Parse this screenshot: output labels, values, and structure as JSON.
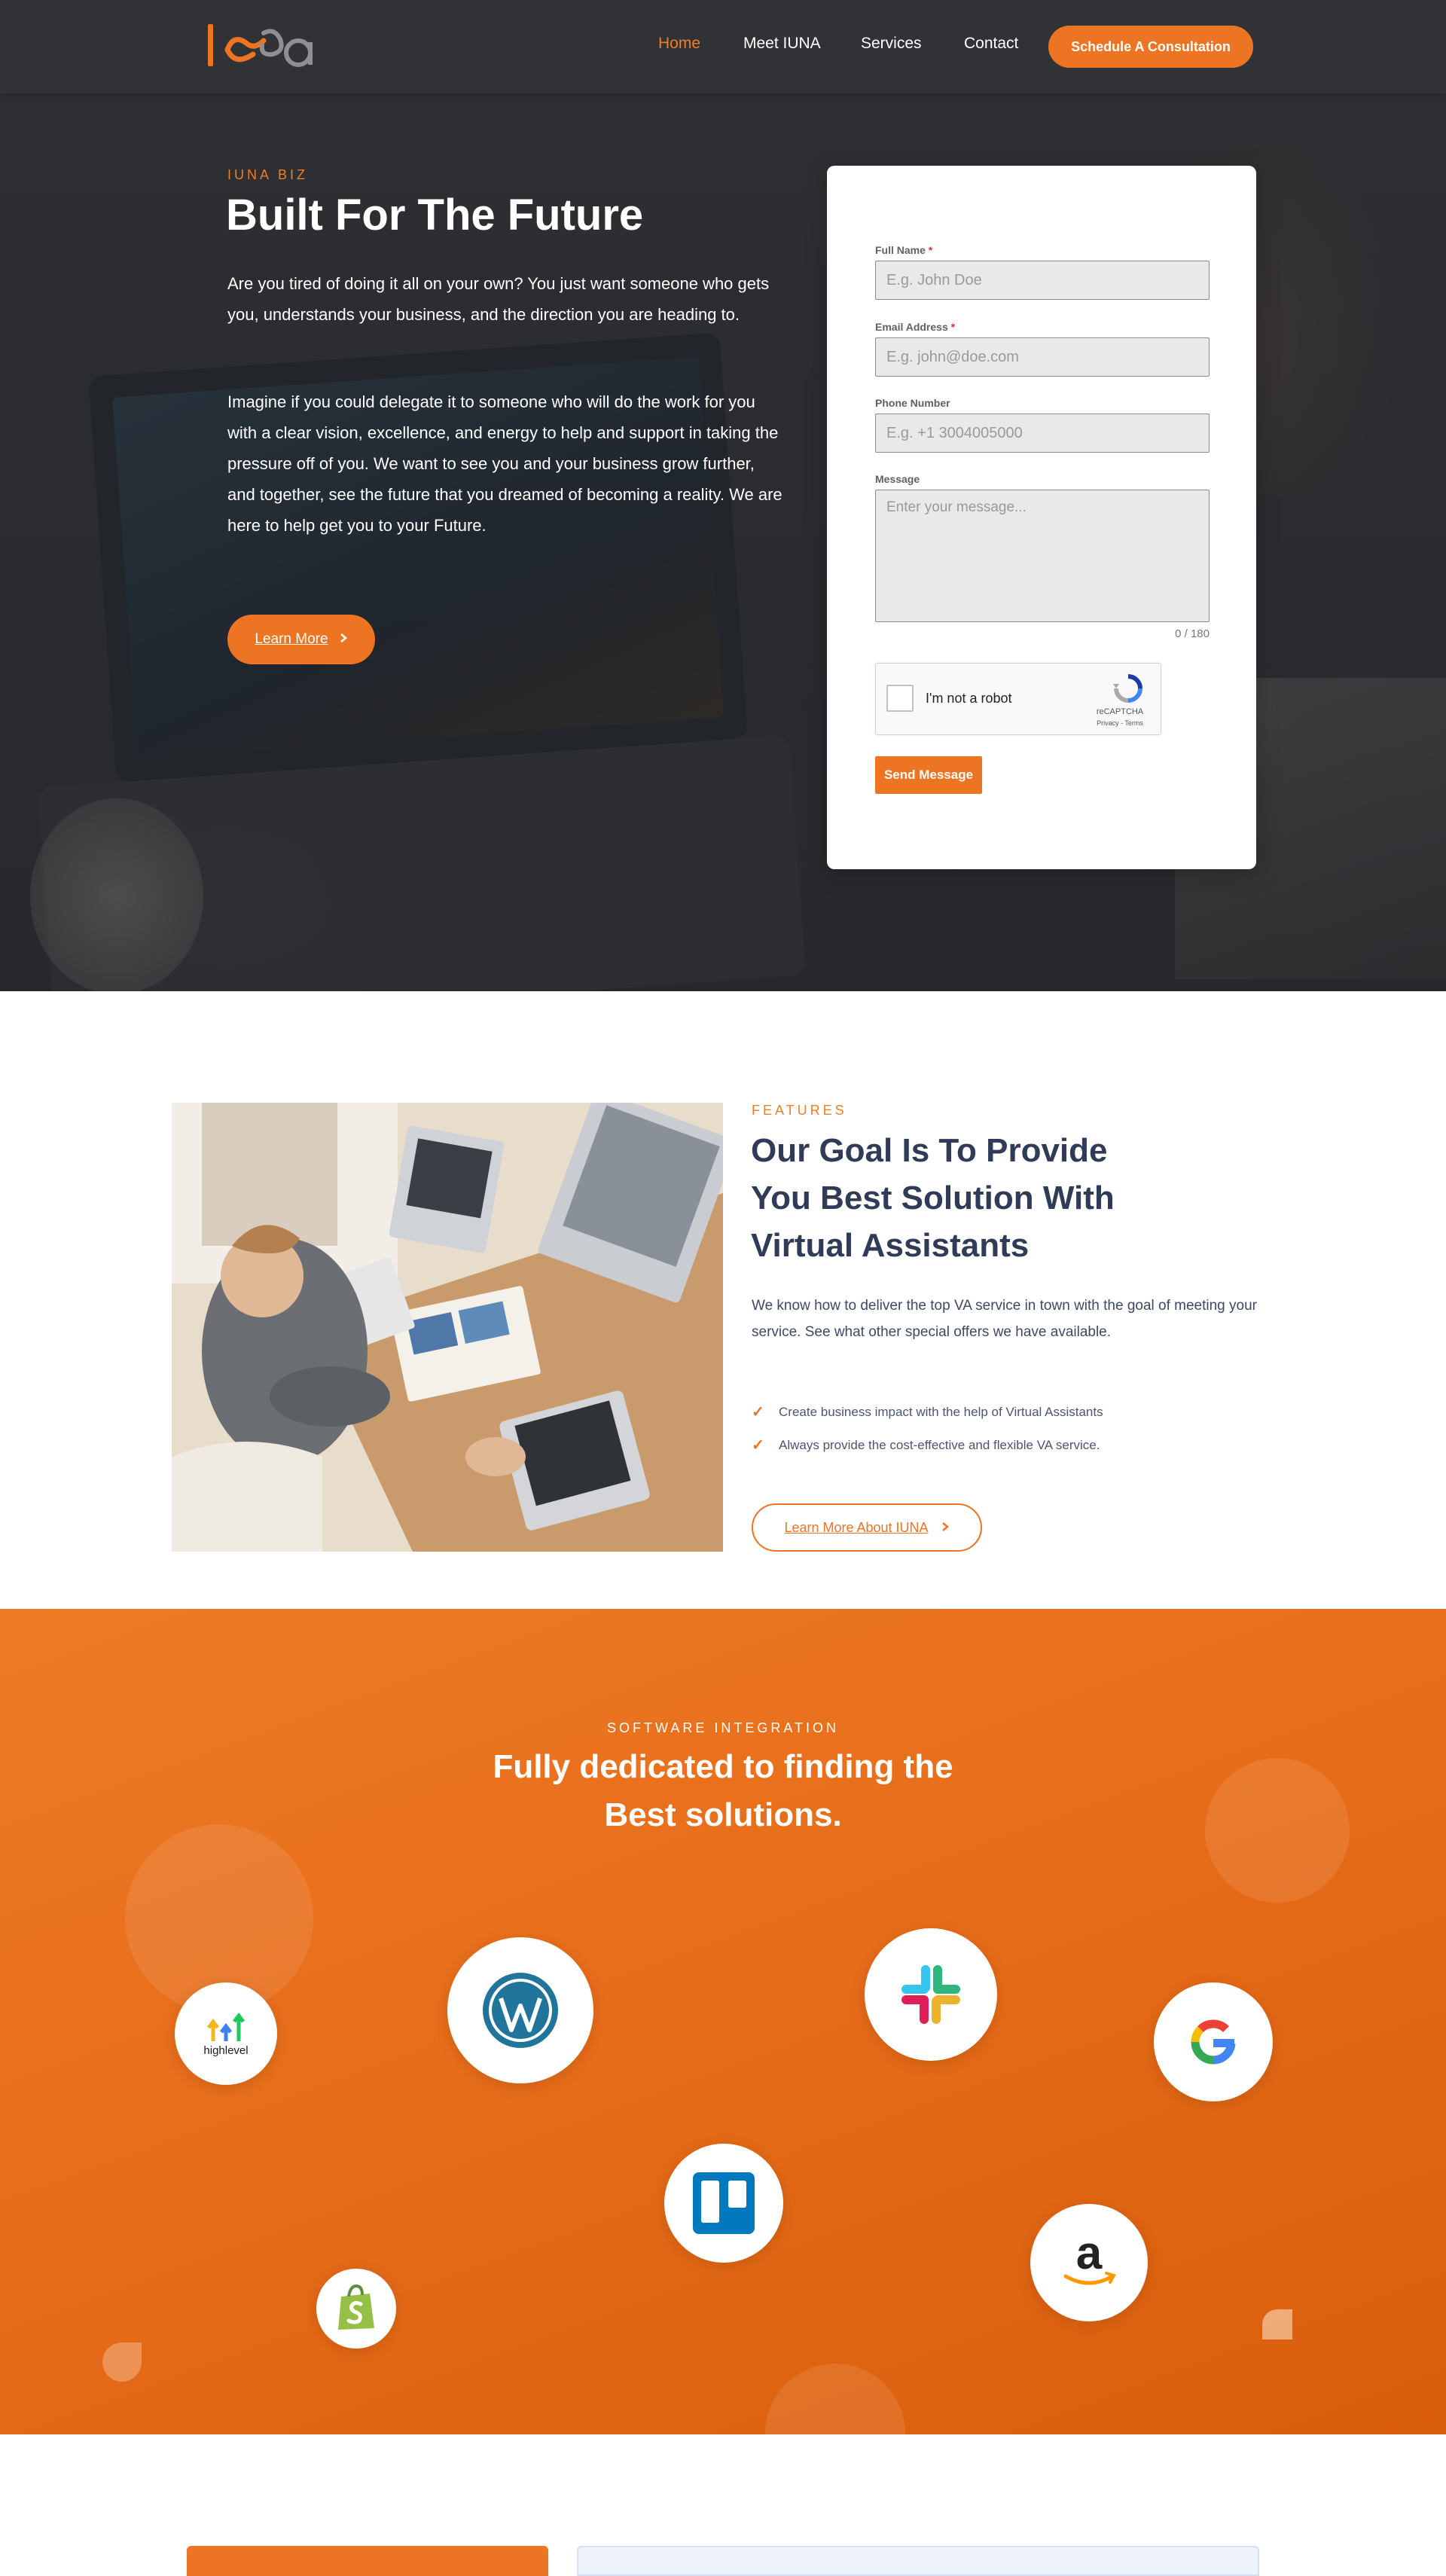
{
  "header": {
    "nav": [
      {
        "label": "Home",
        "active": true
      },
      {
        "label": "Meet IUNA",
        "active": false
      },
      {
        "label": "Services",
        "active": false
      },
      {
        "label": "Contact",
        "active": false
      }
    ],
    "cta_label": "Schedule A Consultation"
  },
  "hero": {
    "eyebrow": "IUNA BIZ",
    "title": "Built For The Future",
    "paragraph1": "Are you tired of doing it all on your own? You just want someone who gets you, understands your business, and the direction you are heading to.",
    "paragraph2": "Imagine if you could delegate it to someone who will do the work for you with a clear vision, excellence, and energy to help and support in taking the pressure off of you. We want to see you and your business grow further, and together, see the future that you dreamed of becoming a reality. We are here to help get you to your Future.",
    "button_label": "Learn More"
  },
  "contact_form": {
    "full_name": {
      "label": "Full Name",
      "required_mark": "*",
      "placeholder": "E.g. John Doe"
    },
    "email": {
      "label": "Email Address",
      "required_mark": "*",
      "placeholder": "E.g. john@doe.com"
    },
    "phone": {
      "label": "Phone Number",
      "placeholder": "E.g. +1 3004005000"
    },
    "message": {
      "label": "Message",
      "placeholder": "Enter your message...",
      "counter": "0 / 180"
    },
    "captcha": {
      "label": "I'm not a robot",
      "brand": "reCAPTCHA",
      "links": "Privacy - Terms"
    },
    "submit_label": "Send Message"
  },
  "features": {
    "eyebrow": "FEATURES",
    "title": "Our Goal Is To Provide You Best Solution With Virtual Assistants",
    "paragraph": "We know how to deliver the top VA service in town with the goal of meeting your service. See what other special offers we have available.",
    "checklist": [
      "Create business impact with the help of Virtual Assistants",
      "Always provide the cost-effective and flexible VA service."
    ],
    "button_label": "Learn More About IUNA"
  },
  "integrations": {
    "eyebrow": "SOFTWARE INTEGRATION",
    "title_line1": "Fully dedicated to finding the",
    "title_line2": "Best solutions.",
    "logos": [
      {
        "name": "highlevel",
        "text": "highlevel"
      },
      {
        "name": "wordpress"
      },
      {
        "name": "slack"
      },
      {
        "name": "google"
      },
      {
        "name": "shopify"
      },
      {
        "name": "trello"
      },
      {
        "name": "amazon"
      }
    ]
  },
  "colors": {
    "accent": "#ed7422",
    "heading_dark": "#2f3b57"
  }
}
